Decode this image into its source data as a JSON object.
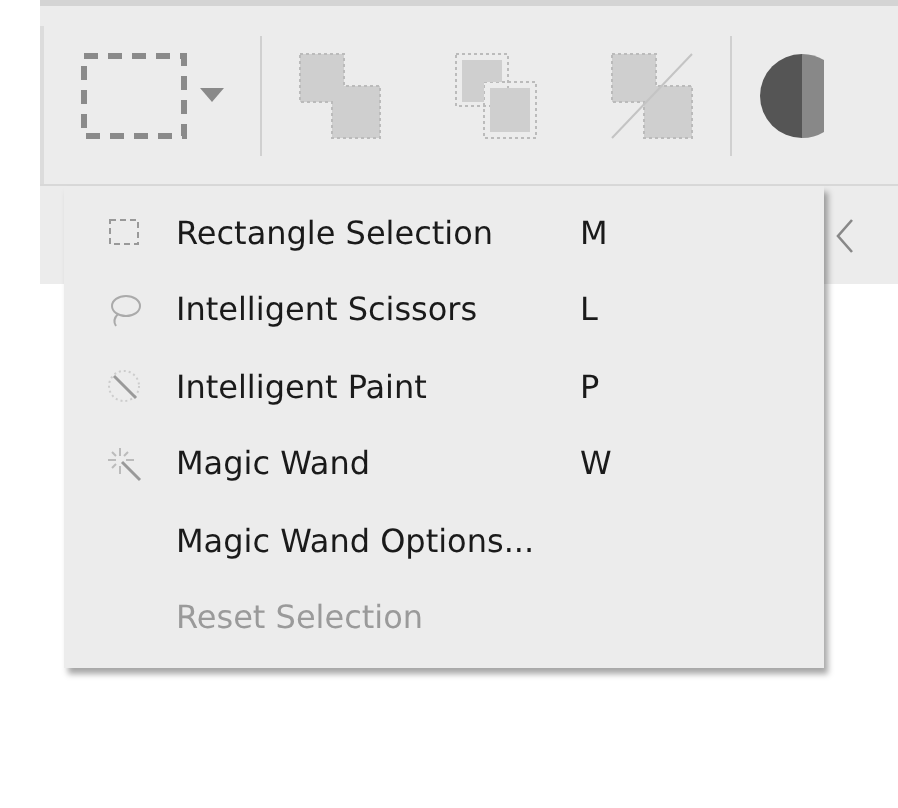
{
  "toolbar": {
    "tools": [
      {
        "kind": "marquee"
      },
      {
        "kind": "union"
      },
      {
        "kind": "intersect"
      },
      {
        "kind": "exclude"
      },
      {
        "kind": "contrast"
      }
    ]
  },
  "menu": {
    "items": [
      {
        "kind": "rectangle",
        "label": "Rectangle Selection",
        "shortcut": "M",
        "disabled": false
      },
      {
        "kind": "lasso",
        "label": "Intelligent Scissors",
        "shortcut": "L",
        "disabled": false
      },
      {
        "kind": "paint",
        "label": "Intelligent Paint",
        "shortcut": "P",
        "disabled": false
      },
      {
        "kind": "wand",
        "label": "Magic Wand",
        "shortcut": "W",
        "disabled": false
      },
      {
        "kind": "plain",
        "label": "Magic Wand Options...",
        "disabled": false
      },
      {
        "kind": "plain",
        "label": "Reset Selection",
        "disabled": true
      }
    ]
  }
}
